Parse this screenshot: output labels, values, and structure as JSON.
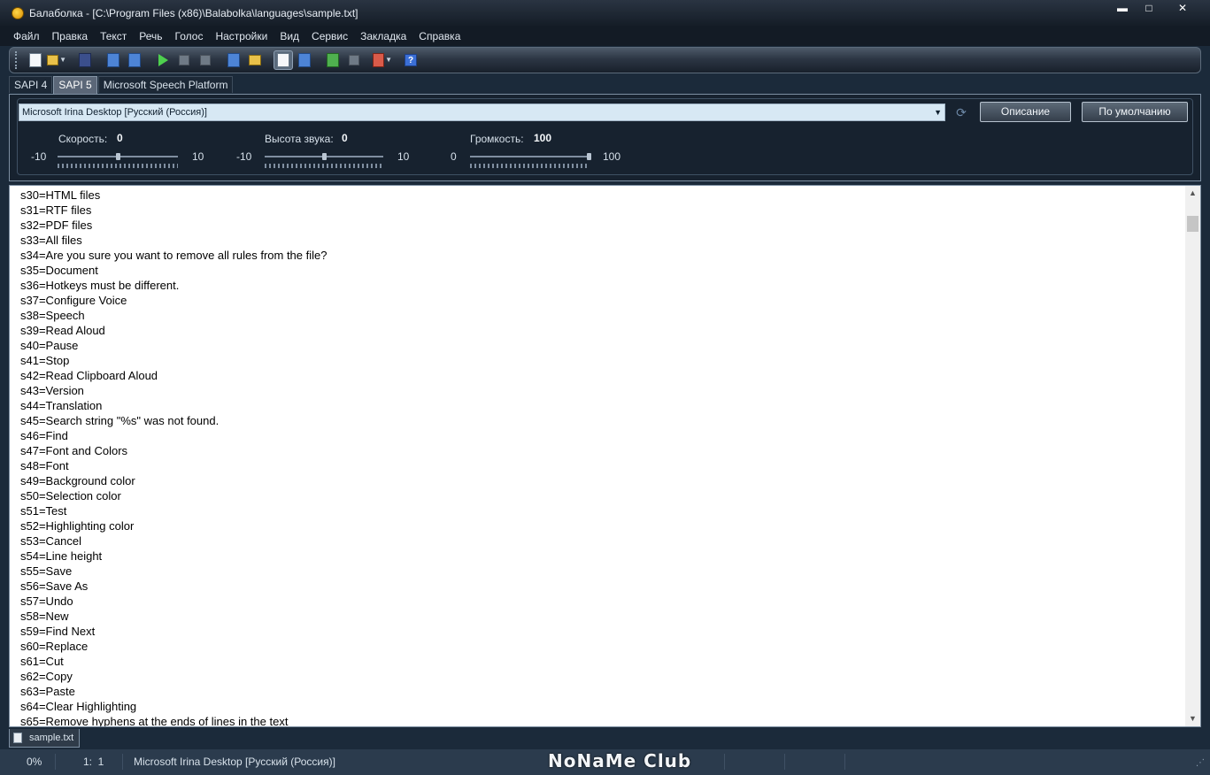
{
  "window": {
    "title": "Балаболка - [C:\\Program Files (x86)\\Balabolka\\languages\\sample.txt]",
    "minimize": "▬",
    "maximize": "□",
    "close": "✕"
  },
  "menu": [
    "Файл",
    "Правка",
    "Текст",
    "Речь",
    "Голос",
    "Настройки",
    "Вид",
    "Сервис",
    "Закладка",
    "Справка"
  ],
  "toolbar": {
    "icons": [
      "new-document-icon",
      "open-folder-icon",
      "save-icon",
      "convert-icon",
      "convert-batch-icon",
      "play-icon",
      "pause-icon",
      "stop-icon",
      "read-clipboard-icon",
      "open-clipboard-icon",
      "text-editor-icon",
      "spelling-icon",
      "split-icon",
      "merge-icon",
      "bookmark-icon",
      "help-icon"
    ]
  },
  "sapi_tabs": [
    "SAPI 4",
    "SAPI 5",
    "Microsoft Speech Platform"
  ],
  "voice": {
    "selected": "Microsoft Irina Desktop [Русский (Россия)]",
    "describe_button": "Описание",
    "defaults_button": "По умолчанию"
  },
  "sliders": {
    "rate": {
      "label": "Скорость:",
      "value": "0",
      "min": "-10",
      "max": "10",
      "level": 0.5
    },
    "pitch": {
      "label": "Высота звука:",
      "value": "0",
      "min": "-10",
      "max": "10",
      "level": 0.5
    },
    "volume": {
      "label": "Громкость:",
      "value": "100",
      "min": "0",
      "max": "100",
      "level": 1.0
    }
  },
  "editor": {
    "lines": [
      "s30=HTML files",
      "s31=RTF files",
      "s32=PDF files",
      "s33=All files",
      "s34=Are you sure you want to remove all rules from the file?",
      "s35=Document",
      "s36=Hotkeys must be different.",
      "s37=Configure Voice",
      "s38=Speech",
      "s39=Read Aloud",
      "s40=Pause",
      "s41=Stop",
      "s42=Read Clipboard Aloud",
      "s43=Version",
      "s44=Translation",
      "s45=Search string \"%s\" was not found.",
      "s46=Find",
      "s47=Font and Colors",
      "s48=Font",
      "s49=Background color",
      "s50=Selection color",
      "s51=Test",
      "s52=Highlighting color",
      "s53=Cancel",
      "s54=Line height",
      "s55=Save",
      "s56=Save As",
      "s57=Undo",
      "s58=New",
      "s59=Find Next",
      "s60=Replace",
      "s61=Cut",
      "s62=Copy",
      "s63=Paste",
      "s64=Clear Highlighting",
      "s65=Remove hyphens at the ends of lines in the text"
    ]
  },
  "file_tab": "sample.txt",
  "status": {
    "progress": "0%",
    "position": "1:  1",
    "voice": "Microsoft Irina Desktop [Русский (Россия)]",
    "watermark": "NoNaMe Club"
  }
}
